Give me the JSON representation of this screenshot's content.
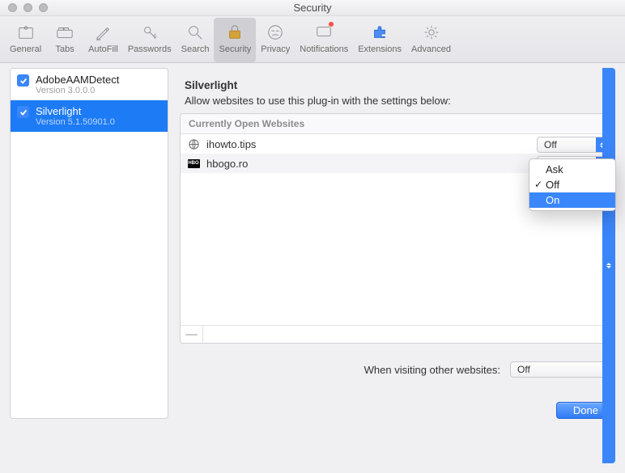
{
  "window": {
    "title": "Security"
  },
  "toolbar": {
    "items": [
      {
        "id": "general",
        "label": "General"
      },
      {
        "id": "tabs",
        "label": "Tabs"
      },
      {
        "id": "autofill",
        "label": "AutoFill"
      },
      {
        "id": "passwords",
        "label": "Passwords"
      },
      {
        "id": "search",
        "label": "Search"
      },
      {
        "id": "security",
        "label": "Security",
        "selected": true
      },
      {
        "id": "privacy",
        "label": "Privacy"
      },
      {
        "id": "notifications",
        "label": "Notifications",
        "badge": true
      },
      {
        "id": "extensions",
        "label": "Extensions"
      },
      {
        "id": "advanced",
        "label": "Advanced"
      }
    ]
  },
  "sidebar": {
    "plugins": [
      {
        "name": "AdobeAAMDetect",
        "version_label": "Version 3.0.0.0",
        "checked": true,
        "selected": false
      },
      {
        "name": "Silverlight",
        "version_label": "Version 5.1.50901.0",
        "checked": true,
        "selected": true
      }
    ]
  },
  "main": {
    "heading": "Silverlight",
    "subheading": "Allow websites to use this plug-in with the settings below:",
    "table_header": "Currently Open Websites",
    "websites": [
      {
        "host": "ihowto.tips",
        "value": "Off",
        "icon": "globe"
      },
      {
        "host": "hbogo.ro",
        "value": "Off",
        "icon": "hbo",
        "menu_open": true
      }
    ],
    "menu": {
      "options": [
        {
          "label": "Ask"
        },
        {
          "label": "Off",
          "checked": true
        },
        {
          "label": "On",
          "highlighted": true
        }
      ]
    },
    "footer_remove_label": "—",
    "other_sites_label": "When visiting other websites:",
    "other_sites_value": "Off",
    "done_label": "Done"
  }
}
